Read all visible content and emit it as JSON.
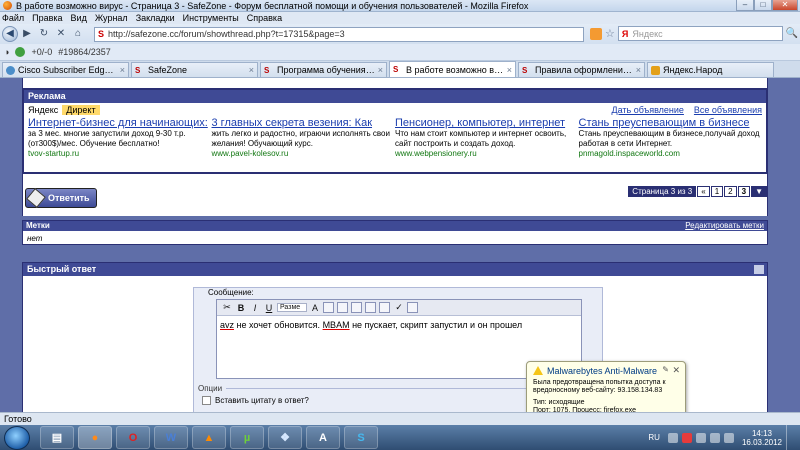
{
  "window": {
    "title": "В работе возможно вирус - Страница 3 - SafeZone - Форум бесплатной помощи и обучения пользователей - Mozilla Firefox",
    "buttons": [
      "–",
      "□",
      "✕"
    ]
  },
  "menu": [
    "Файл",
    "Правка",
    "Вид",
    "Журнал",
    "Закладки",
    "Инструменты",
    "Справка"
  ],
  "nav": {
    "url": "http://safezone.cc/forum/showthread.php?t=17315&page=3",
    "search_placeholder": "Яндекс",
    "search_brand": "Я"
  },
  "toolbar2": {
    "counter": "+0/-0",
    "id": "#19864/2357"
  },
  "tabs": [
    {
      "label": "Cisco Subscriber Edge Service...",
      "active": false
    },
    {
      "label": "SafeZone",
      "active": false
    },
    {
      "label": "Программа обучения по \"л...",
      "active": false
    },
    {
      "label": "В работе возможно вирус ...",
      "active": true
    },
    {
      "label": "Правила оформления запро...",
      "active": false
    },
    {
      "label": "Яндекс.Народ",
      "active": false
    }
  ],
  "ads": {
    "header": "Реклама",
    "yandex": "Яндекс",
    "direct": "Директ",
    "give_ad": "Дать объявление",
    "all_ads": "Все объявления",
    "items": [
      {
        "title": "Интернет-бизнес для начинающих:",
        "text": "за 3 мес. многие запустили доход 9-30 т.р.(от300$)/мес. Обучение бесплатно!",
        "url": "tvov-startup.ru"
      },
      {
        "title": "3 главных секрета везения: Как",
        "text": "жить легко и радостно, играючи исполнять свои желания! Обучающий курс.",
        "url": "www.pavel-kolesov.ru"
      },
      {
        "title": "Пенсионер, компьютер, интернет",
        "text": "Что нам стоит компьютер и интернет освоить, сайт построить и создать доход.",
        "url": "www.webpensionery.ru"
      },
      {
        "title": "Стань преуспевающим в бизнесе",
        "text": "Стань преуспевающим в бизнесе,получай доход работая в сети Интернет.",
        "url": "pnmagold.inspaceworld.com"
      }
    ]
  },
  "reply": {
    "button": "Ответить",
    "pager_info": "Страница 3 из 3",
    "pages": [
      "«",
      "1",
      "2",
      "3"
    ]
  },
  "tags": {
    "header": "Метки",
    "edit": "Редактировать метки",
    "value": "нет"
  },
  "quick_reply": {
    "header": "Быстрый ответ",
    "message_label": "Сообщение:",
    "font_select": "Разме",
    "text_prefix": "avz",
    "text_mid": " не хочет обновится. ",
    "text_mbam": "MBAM",
    "text_suffix": " не пускает, скрипт запустил и он прошел",
    "options_label": "Опции",
    "quote_label": "Вставить цитату в ответ?"
  },
  "balloon": {
    "title": "Malwarebytes Anti-Malware",
    "line1": "Была предотвращена попытка доступа к вредоносному веб-сайту:  93.158.134.83",
    "line2": "Тип:  исходящие",
    "line3": "Порт: 1075, Процесс:  firefox.exe"
  },
  "status": "Готово",
  "taskbar": {
    "apps": [
      "Firefox",
      "Opera",
      "Word",
      "VLC",
      "uTorrent",
      "App",
      "A",
      "Skype"
    ],
    "lang": "RU",
    "time": "14:13",
    "date": "16.03.2012"
  }
}
